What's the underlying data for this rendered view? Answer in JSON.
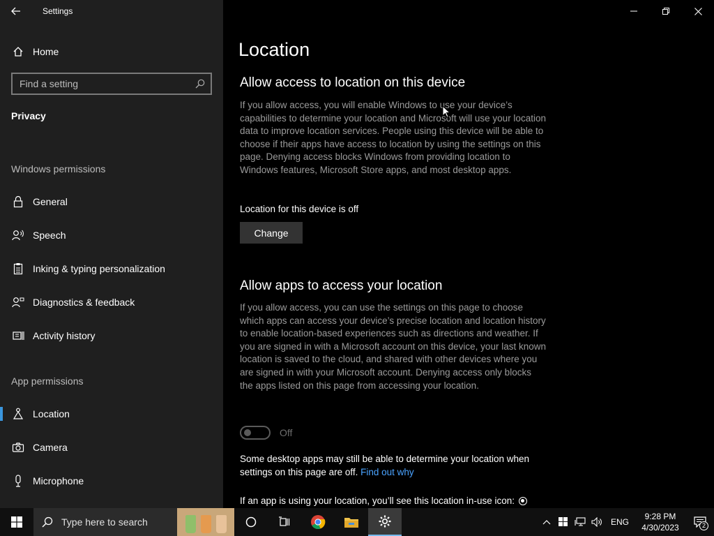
{
  "window": {
    "title": "Settings"
  },
  "sidebar": {
    "home_label": "Home",
    "search_placeholder": "Find a setting",
    "section": "Privacy",
    "windows_permissions_label": "Windows permissions",
    "windows_permissions": [
      {
        "label": "General",
        "icon": "lock-icon"
      },
      {
        "label": "Speech",
        "icon": "speech-icon"
      },
      {
        "label": "Inking & typing personalization",
        "icon": "clipboard-icon"
      },
      {
        "label": "Diagnostics & feedback",
        "icon": "people-feedback-icon"
      },
      {
        "label": "Activity history",
        "icon": "activity-history-icon"
      }
    ],
    "app_permissions_label": "App permissions",
    "app_permissions": [
      {
        "label": "Location",
        "icon": "location-icon",
        "selected": true
      },
      {
        "label": "Camera",
        "icon": "camera-icon"
      },
      {
        "label": "Microphone",
        "icon": "microphone-icon"
      }
    ]
  },
  "main": {
    "title": "Location",
    "device_section": {
      "heading": "Allow access to location on this device",
      "description": "If you allow access, you will enable Windows to use your device’s capabilities to determine your location and Microsoft will use your location data to improve location services. People using this device will be able to choose if their apps have access to location by using the settings on this page. Denying access blocks Windows from providing location to Windows features, Microsoft Store apps, and most desktop apps.",
      "status": "Location for this device is off",
      "button_label": "Change"
    },
    "apps_section": {
      "heading": "Allow apps to access your location",
      "description": "If you allow access, you can use the settings on this page to choose which apps can access your device’s precise location and location history to enable location-based experiences such as directions and weather. If you are signed in with a Microsoft account on this device, your last known location is saved to the cloud, and shared with other devices where you are signed in with your Microsoft account. Denying access only blocks the apps listed on this page from accessing your location.",
      "toggle_state": "Off",
      "note_text": "Some desktop apps may still be able to determine your location when settings on this page are off.",
      "note_link": "Find out why",
      "in_use_text": "If an app is using your location, you’ll see this location in-use icon:"
    }
  },
  "taskbar": {
    "search_placeholder": "Type here to search",
    "apps": [
      "task-view-icon",
      "chrome-icon",
      "file-explorer-icon",
      "settings-icon"
    ],
    "language": "ENG",
    "time": "9:28 PM",
    "date": "4/30/2023",
    "notification_count": "2"
  },
  "colors": {
    "accent": "#3a96dd",
    "link": "#4aa3ff",
    "sidebar_bg": "#1f1f1f",
    "main_bg": "#000000"
  }
}
